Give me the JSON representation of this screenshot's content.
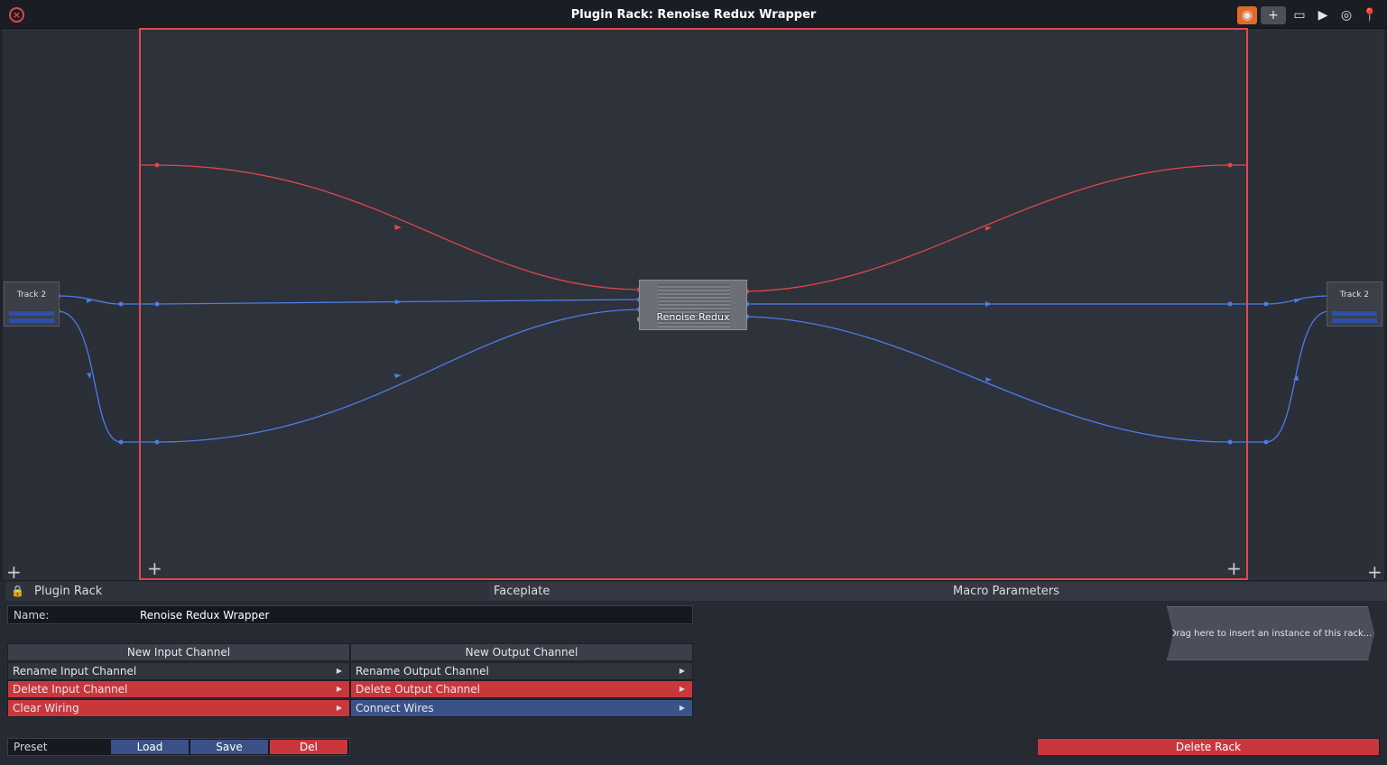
{
  "window": {
    "title": "Plugin Rack: Renoise Redux Wrapper",
    "close_icon": "close-icon",
    "toolbar_icons": [
      "record-icon",
      "add-icon",
      "layout-icon",
      "forward-icon",
      "eye-icon",
      "pin-icon"
    ]
  },
  "graph": {
    "input_node_label": "Track 2",
    "output_node_label": "Track 2",
    "plugin_label": "Renoise Redux",
    "wire_colors": {
      "sidechain": "#e1474c",
      "audio": "#4b7ee8"
    }
  },
  "panel": {
    "title": "Plugin Rack",
    "faceplate_tab": "Faceplate",
    "macro_tab": "Macro Parameters",
    "name_label": "Name:",
    "name_value": "Renoise Redux Wrapper",
    "new_input_channel": "New Input Channel",
    "new_output_channel": "New Output Channel",
    "rename_input_channel": "Rename Input Channel",
    "rename_output_channel": "Rename Output Channel",
    "delete_input_channel": "Delete Input Channel",
    "delete_output_channel": "Delete Output Channel",
    "clear_wiring": "Clear Wiring",
    "connect_wires": "Connect Wires",
    "drag_hint": "Drag here to insert an instance of this rack...",
    "preset_label": "Preset",
    "load": "Load",
    "save": "Save",
    "del": "Del",
    "delete_rack": "Delete Rack"
  }
}
